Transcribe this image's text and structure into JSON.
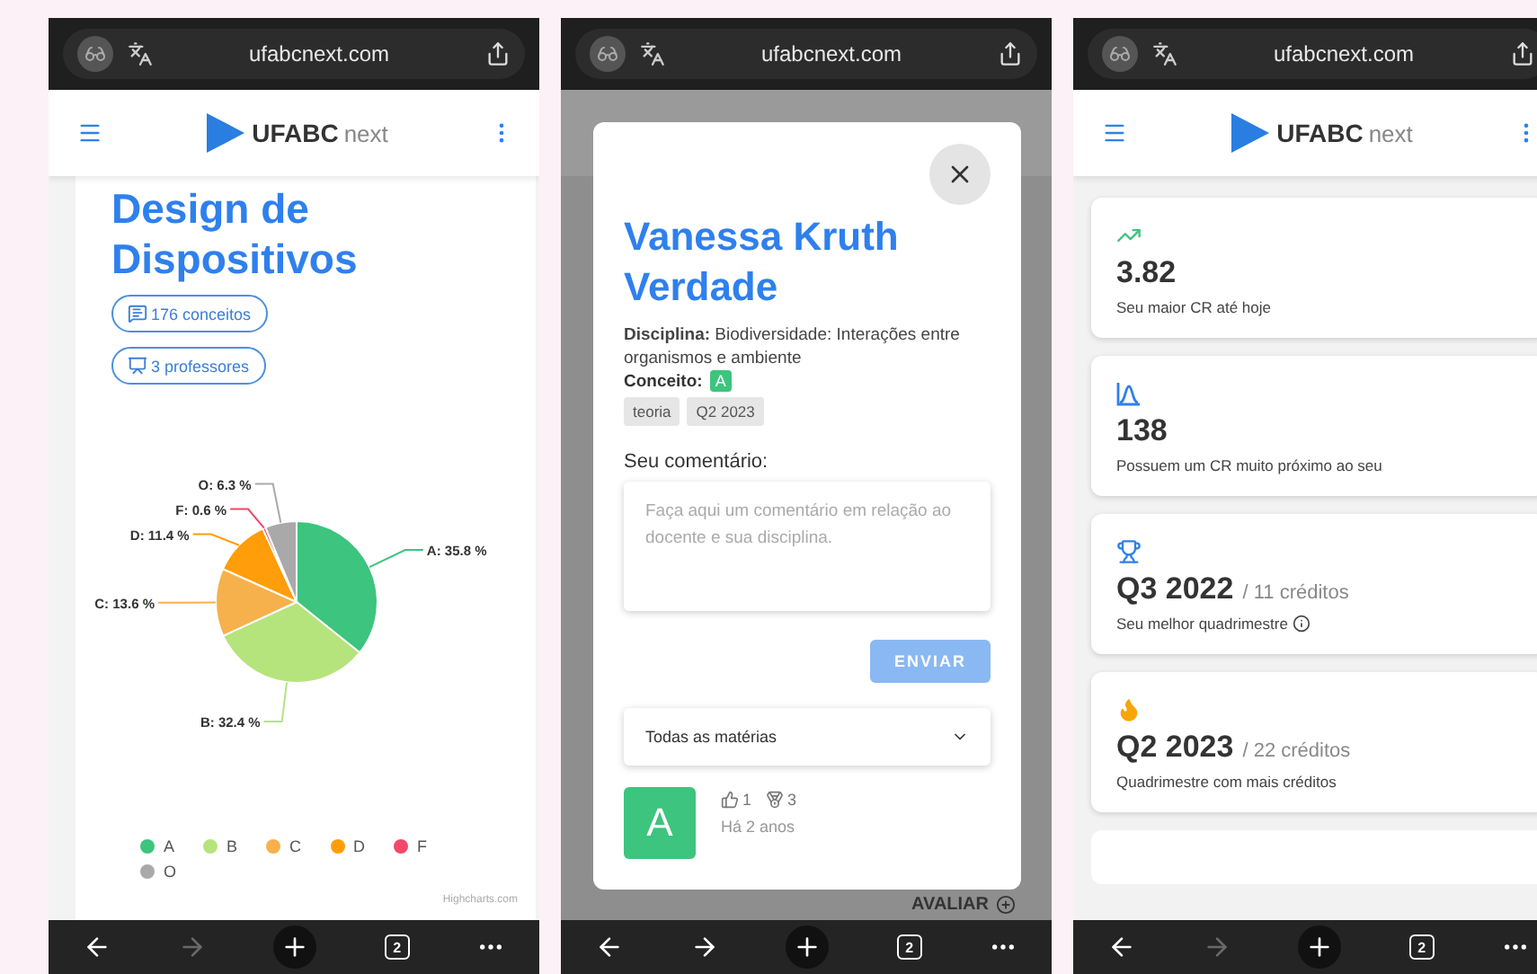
{
  "phones": [
    {
      "kind": "subject",
      "browser": {
        "url": "ufabcnext.com",
        "forward_enabled": false,
        "tabs_count": "2"
      },
      "header": {
        "logo_main": "UFABC",
        "logo_sub": "next"
      },
      "title": "Design de Dispositivos",
      "chips": [
        {
          "kind": "comments",
          "label": "176 conceitos"
        },
        {
          "kind": "teachers",
          "label": "3 professores"
        }
      ],
      "chart_data": {
        "type": "pie",
        "categories": [
          "A",
          "B",
          "C",
          "D",
          "F",
          "O"
        ],
        "values": [
          35.8,
          32.4,
          13.6,
          11.4,
          0.6,
          6.3
        ],
        "data_labels": true,
        "value_labels": [
          "A: 35.8 %",
          "B: 32.4 %",
          "C: 13.6 %",
          "D: 11.4 %",
          "F: 0.6 %",
          "O: 6.3 %"
        ]
      },
      "legend": [
        {
          "color": "#3dc47e"
        },
        {
          "color": "#b6e47c"
        },
        {
          "color": "#f6b14c"
        },
        {
          "color": "#ff9d0a"
        },
        {
          "color": "#f3476a"
        },
        {
          "color": "#a9a9a9"
        }
      ],
      "credit": "Highcharts.com"
    },
    {
      "kind": "teacher-modal",
      "browser": {
        "url": "ufabcnext.com",
        "forward_enabled": true,
        "tabs_count": "2"
      },
      "modal": {
        "name": "Vanessa Kruth Verdade",
        "discipline": "**Disciplina:** Biodiversidade: Interações entre organismos e ambiente",
        "concept_label": "Conceito:",
        "concept": "A",
        "tags": [
          "teoria",
          "Q2 2023"
        ],
        "comment_label": "Seu comentário:",
        "comment_placeholder": "Faça aqui um comentário em relação ao docente e sua disciplina.",
        "send": {
          "label": "ENVIAR",
          "disabled": true
        },
        "filter": "Todas as matérias",
        "comment": {
          "avatar": "A",
          "likes": "1",
          "recommendations": "3",
          "time": "Há 2 anos"
        }
      },
      "behind_action": "AVALIAR"
    },
    {
      "kind": "stats",
      "browser": {
        "url": "ufabcnext.com",
        "forward_enabled": false,
        "tabs_count": "2"
      },
      "header": {
        "logo_main": "UFABC",
        "logo_sub": "next"
      },
      "cards": [
        {
          "kind": "trend",
          "value": "3.82",
          "caption": "Seu maior CR até hoje",
          "info": false
        },
        {
          "kind": "curve",
          "value": "138",
          "caption": "Possuem um CR muito próximo ao seu",
          "info": false
        },
        {
          "kind": "trophy",
          "value": "Q3 2022",
          "suffix": "/ 11 créditos",
          "caption": "Seu melhor quadrimestre",
          "info": true
        },
        {
          "kind": "flame",
          "value": "Q2 2023",
          "suffix": "/ 22 créditos",
          "caption": "Quadrimestre com mais créditos",
          "info": false
        }
      ]
    }
  ]
}
